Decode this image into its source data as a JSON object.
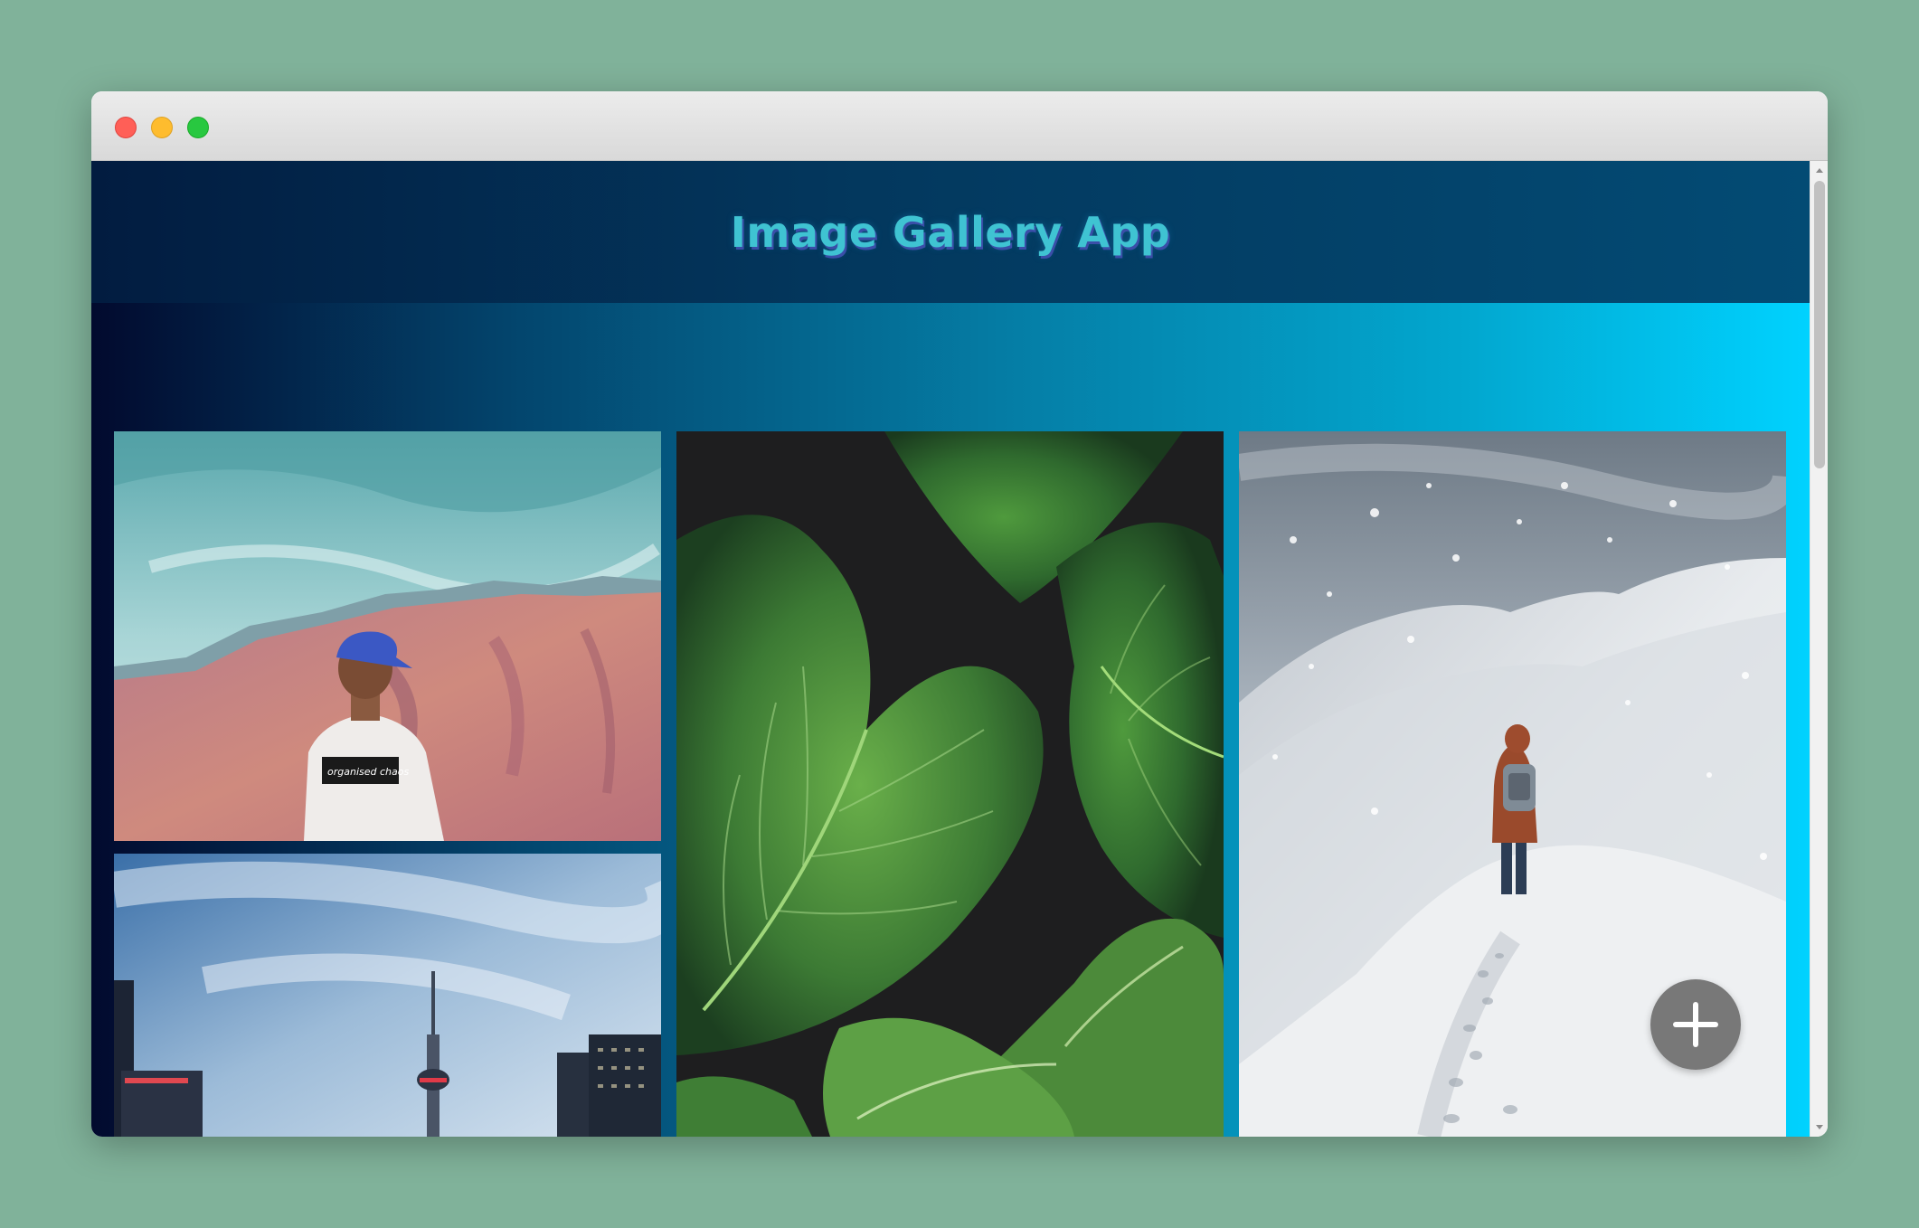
{
  "app": {
    "title": "Image Gallery App"
  },
  "gallery": {
    "images": [
      {
        "subject": "man in cap in front of mountains",
        "shirt_text": "organised chaos"
      },
      {
        "subject": "city skyline with tower"
      },
      {
        "subject": "green leaves"
      },
      {
        "subject": "hiker on snowy ridge"
      }
    ]
  },
  "fab": {
    "icon": "plus-icon"
  },
  "colors": {
    "header_bg": "#03385e",
    "title_text": "#3fc3d2",
    "gradient_start": "#020a2e",
    "gradient_end": "#00d2ff",
    "fab_bg": "#6e6e6e"
  }
}
